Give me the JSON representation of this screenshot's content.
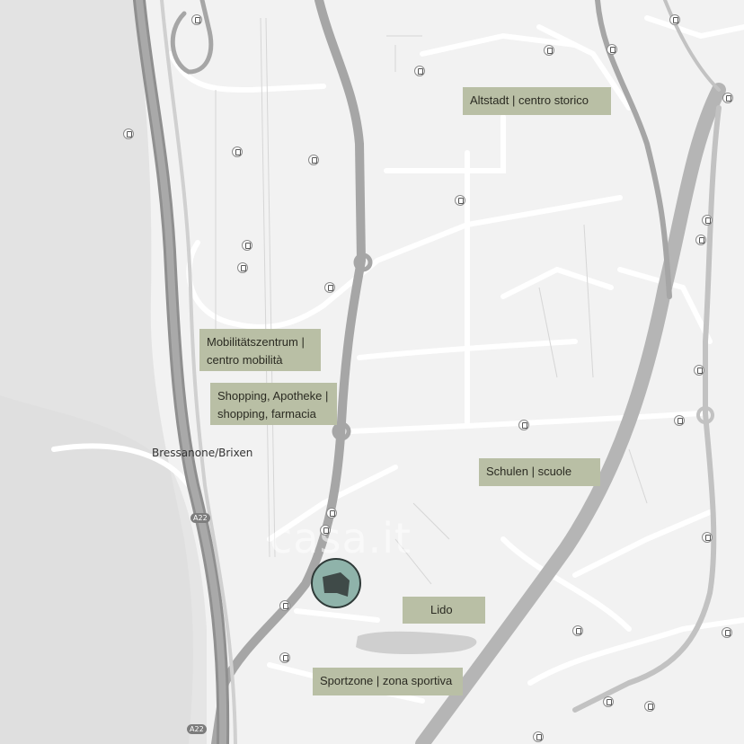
{
  "map": {
    "town_label": "Bressanone/Brixen",
    "highway_shields": [
      "A22",
      "A22"
    ],
    "watermark": "casa.it",
    "pois": [
      {
        "id": "altstadt",
        "text": "Altstadt | centro storico"
      },
      {
        "id": "mobilitaet",
        "text": "Mobilitätszentrum | centro mobilità"
      },
      {
        "id": "shopping",
        "text": "Shopping, Apotheke | shopping, farmacia"
      },
      {
        "id": "schulen",
        "text": "Schulen | scuole"
      },
      {
        "id": "lido",
        "text": "Lido"
      },
      {
        "id": "sport",
        "text": "Sportzone | zona sportiva"
      }
    ],
    "colors": {
      "background": "#f2f2f2",
      "terrain": "#e3e3e3",
      "major_road": "#a6a6a6",
      "minor_road": "#ffffff",
      "label_bg": "#b9bfa5",
      "marker_fill": "#8fb3aa",
      "marker_shape": "#3f4a48"
    },
    "icons": {
      "bus_stop": "bus-stop-icon",
      "property_marker": "property-location-icon"
    }
  }
}
